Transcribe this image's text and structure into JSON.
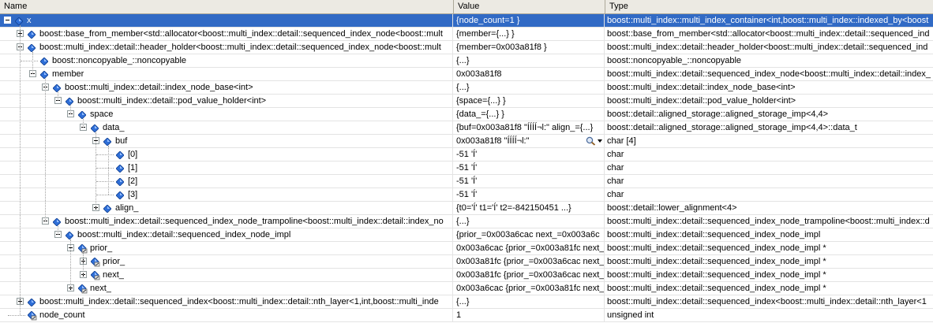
{
  "columns": {
    "name": "Name",
    "value": "Value",
    "type": "Type"
  },
  "icons": {
    "field": "member-diamond-icon",
    "reference": "reference-member-icon",
    "visualizer": "magnifier-icon"
  },
  "colors": {
    "selection": "#316ac5",
    "grid": "#e3e3e3",
    "header": "#eceae3"
  },
  "rows": [
    {
      "depth": 0,
      "exp": "minus",
      "icon": "diamond",
      "selected": true,
      "name": "x",
      "value": "{node_count=1 }",
      "type": "boost::multi_index::multi_index_container<int,boost::multi_index::indexed_by<boost"
    },
    {
      "depth": 1,
      "exp": "plus",
      "icon": "diamond",
      "name": "boost::base_from_member<std::allocator<boost::multi_index::detail::sequenced_index_node<boost::mult",
      "value": "{member={...} }",
      "type": "boost::base_from_member<std::allocator<boost::multi_index::detail::sequenced_ind"
    },
    {
      "depth": 1,
      "exp": "minus",
      "icon": "diamond",
      "name": "boost::multi_index::detail::header_holder<boost::multi_index::detail::sequenced_index_node<boost::mult",
      "value": "{member=0x003a81f8 }",
      "type": "boost::multi_index::detail::header_holder<boost::multi_index::detail::sequenced_ind"
    },
    {
      "depth": 2,
      "exp": "none",
      "icon": "diamond",
      "name": "boost::noncopyable_::noncopyable",
      "value": "{...}",
      "type": "boost::noncopyable_::noncopyable"
    },
    {
      "depth": 2,
      "exp": "minus",
      "icon": "diamond",
      "name": "member",
      "value": "0x003a81f8",
      "type": "boost::multi_index::detail::sequenced_index_node<boost::multi_index::detail::index_"
    },
    {
      "depth": 3,
      "exp": "minus",
      "icon": "diamond",
      "name": "boost::multi_index::detail::index_node_base<int>",
      "value": "{...}",
      "type": "boost::multi_index::detail::index_node_base<int>"
    },
    {
      "depth": 4,
      "exp": "minus",
      "icon": "diamond",
      "name": "boost::multi_index::detail::pod_value_holder<int>",
      "value": "{space={...} }",
      "type": "boost::multi_index::detail::pod_value_holder<int>"
    },
    {
      "depth": 5,
      "exp": "minus",
      "icon": "diamond",
      "name": "space",
      "value": "{data_={...} }",
      "type": "boost::detail::aligned_storage::aligned_storage_imp<4,4>"
    },
    {
      "depth": 6,
      "exp": "minus",
      "icon": "diamond",
      "name": "data_",
      "value": "{buf=0x003a81f8 \"ÍÍÍÍ¬l:\" align_={...}",
      "type": "boost::detail::aligned_storage::aligned_storage_imp<4,4>::data_t"
    },
    {
      "depth": 7,
      "exp": "minus",
      "icon": "diamond",
      "vis": true,
      "name": "buf",
      "value": "0x003a81f8 \"ÍÍÍÍ¬l:\"",
      "type": "char [4]"
    },
    {
      "depth": 8,
      "exp": "none",
      "icon": "diamond",
      "name": "[0]",
      "value": "-51 'Í'",
      "type": "char"
    },
    {
      "depth": 8,
      "exp": "none",
      "icon": "diamond",
      "name": "[1]",
      "value": "-51 'Í'",
      "type": "char"
    },
    {
      "depth": 8,
      "exp": "none",
      "icon": "diamond",
      "name": "[2]",
      "value": "-51 'Í'",
      "type": "char"
    },
    {
      "depth": 8,
      "exp": "none",
      "icon": "diamond",
      "name": "[3]",
      "value": "-51 'Í'",
      "type": "char"
    },
    {
      "depth": 7,
      "exp": "plus",
      "icon": "diamond",
      "name": "align_",
      "value": "{t0='Í' t1='Í' t2=-842150451 ...}",
      "type": "boost::detail::lower_alignment<4>"
    },
    {
      "depth": 3,
      "exp": "minus",
      "icon": "diamond",
      "name": "boost::multi_index::detail::sequenced_index_node_trampoline<boost::multi_index::detail::index_no",
      "value": "{...}",
      "type": "boost::multi_index::detail::sequenced_index_node_trampoline<boost::multi_index::d"
    },
    {
      "depth": 4,
      "exp": "minus",
      "icon": "diamond",
      "name": "boost::multi_index::detail::sequenced_index_node_impl",
      "value": "{prior_=0x003a6cac next_=0x003a6c",
      "type": "boost::multi_index::detail::sequenced_index_node_impl"
    },
    {
      "depth": 5,
      "exp": "minus",
      "icon": "ref",
      "name": "prior_",
      "value": "0x003a6cac {prior_=0x003a81fc next_",
      "type": "boost::multi_index::detail::sequenced_index_node_impl *"
    },
    {
      "depth": 6,
      "exp": "plus",
      "icon": "ref",
      "name": "prior_",
      "value": "0x003a81fc {prior_=0x003a6cac next_",
      "type": "boost::multi_index::detail::sequenced_index_node_impl *"
    },
    {
      "depth": 6,
      "exp": "plus",
      "icon": "ref",
      "name": "next_",
      "value": "0x003a81fc {prior_=0x003a6cac next_",
      "type": "boost::multi_index::detail::sequenced_index_node_impl *"
    },
    {
      "depth": 5,
      "exp": "plus",
      "icon": "ref",
      "name": "next_",
      "value": "0x003a6cac {prior_=0x003a81fc next_",
      "type": "boost::multi_index::detail::sequenced_index_node_impl *"
    },
    {
      "depth": 1,
      "exp": "plus",
      "icon": "diamond",
      "name": "boost::multi_index::detail::sequenced_index<boost::multi_index::detail::nth_layer<1,int,boost::multi_inde",
      "value": "{...}",
      "type": "boost::multi_index::detail::sequenced_index<boost::multi_index::detail::nth_layer<1"
    },
    {
      "depth": 1,
      "exp": "none",
      "icon": "ref",
      "name": "node_count",
      "value": "1",
      "type": "unsigned int"
    }
  ]
}
